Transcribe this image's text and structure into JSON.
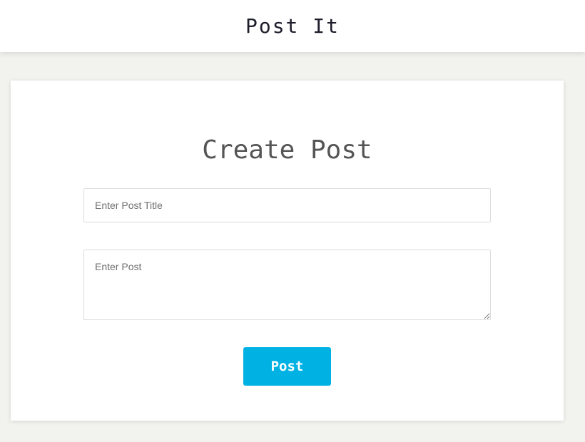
{
  "app": {
    "title": "Post It"
  },
  "form": {
    "heading": "Create Post",
    "title_placeholder": "Enter Post Title",
    "title_value": "",
    "post_placeholder": "Enter Post",
    "post_value": "",
    "submit_label": "Post"
  },
  "colors": {
    "accent": "#00b2e3",
    "page_background": "#f2f2ee",
    "heading_text": "#555555"
  }
}
